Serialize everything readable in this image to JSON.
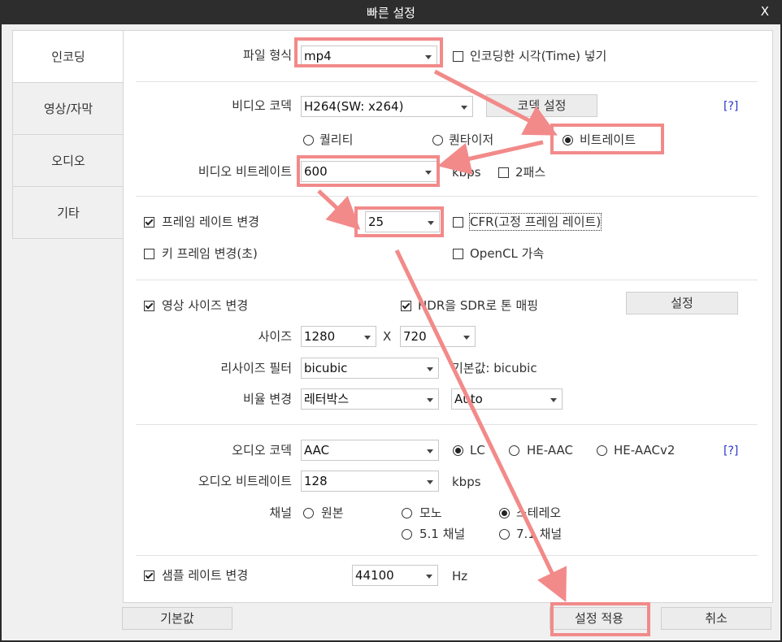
{
  "window": {
    "title": "빠른 설정",
    "close": "X"
  },
  "sidebar": {
    "tabs": [
      "인코딩",
      "영상/자막",
      "오디오",
      "기타"
    ]
  },
  "file": {
    "format_label": "파일 형식",
    "format_value": "mp4",
    "timestamp_label": "인코딩한 시각(Time) 넣기",
    "timestamp_checked": false
  },
  "video": {
    "codec_label": "비디오 코덱",
    "codec_value": "H264(SW: x264)",
    "codec_settings_btn": "코덱 설정",
    "help": "[?]",
    "mode_options": [
      "퀄리티",
      "퀀타이저",
      "비트레이트"
    ],
    "mode_selected": "비트레이트",
    "bitrate_label": "비디오 비트레이트",
    "bitrate_value": "600",
    "bitrate_unit": "kbps",
    "twopass_label": "2패스",
    "twopass_checked": false
  },
  "frame": {
    "rate_change_label": "프레임 레이트 변경",
    "rate_change_checked": true,
    "rate_value": "25",
    "cfr_label": "CFR(고정 프레임 레이트)",
    "cfr_checked": false,
    "keyframe_label": "키 프레임 변경(초)",
    "keyframe_checked": false,
    "opencl_label": "OpenCL 가속",
    "opencl_checked": false
  },
  "size": {
    "resize_label": "영상 사이즈 변경",
    "resize_checked": true,
    "hdr_label": "HDR을 SDR로 톤 매핑",
    "hdr_checked": true,
    "settings_btn": "설정",
    "size_label": "사이즈",
    "width_value": "1280",
    "x": "X",
    "height_value": "720",
    "filter_label": "리사이즈 필터",
    "filter_value": "bicubic",
    "filter_default": "기본값: bicubic",
    "ratio_label": "비율 변경",
    "ratio_value": "레터박스",
    "ratio_mode_value": "Auto"
  },
  "audio": {
    "codec_label": "오디오 코덱",
    "codec_value": "AAC",
    "profile_options": [
      "LC",
      "HE-AAC",
      "HE-AACv2"
    ],
    "profile_selected": "LC",
    "help": "[?]",
    "bitrate_label": "오디오 비트레이트",
    "bitrate_value": "128",
    "bitrate_unit": "kbps",
    "channel_label": "채널",
    "channel_options": [
      "원본",
      "모노",
      "스테레오",
      "5.1 채널",
      "7.1 채널"
    ],
    "channel_selected": "스테레오",
    "samplerate_label": "샘플 레이트 변경",
    "samplerate_checked": true,
    "samplerate_value": "44100",
    "samplerate_unit": "Hz"
  },
  "footer": {
    "default_btn": "기본값",
    "apply_btn": "설정 적용",
    "cancel_btn": "취소"
  },
  "colors": {
    "highlight": "#f28a8a",
    "help_link": "#2b33c9",
    "titlebar": "#2d2d2d"
  }
}
